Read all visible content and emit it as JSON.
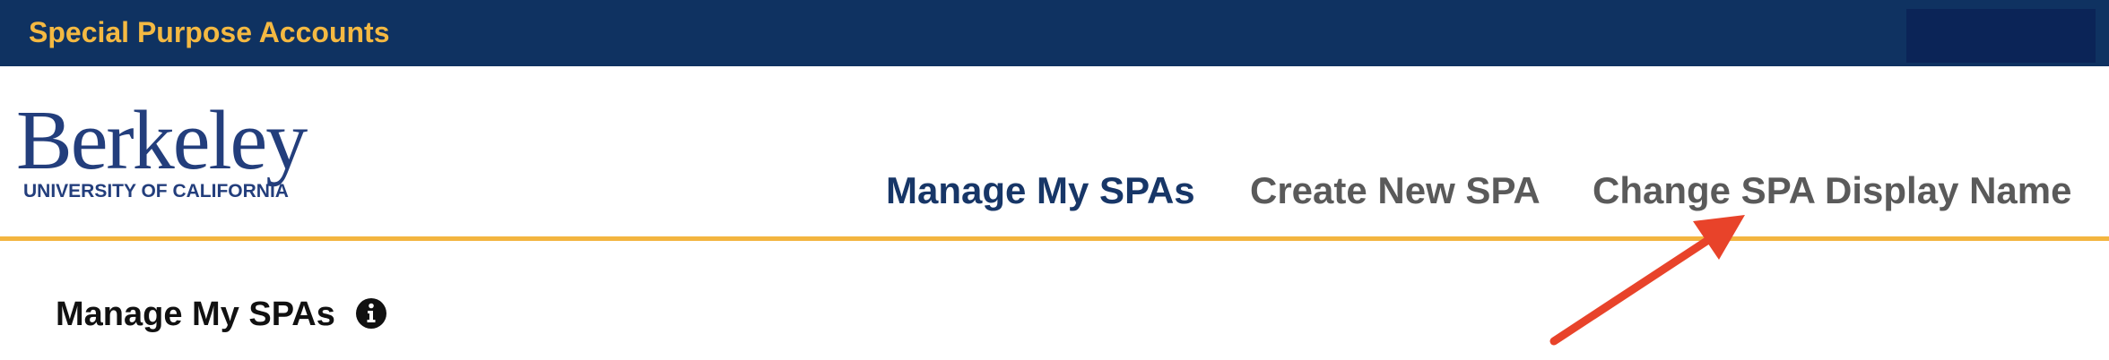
{
  "topbar": {
    "title": "Special Purpose Accounts"
  },
  "logo": {
    "wordmark": "Berkeley",
    "subtitle": "UNIVERSITY OF CALIFORNIA"
  },
  "nav": {
    "items": [
      {
        "label": "Manage My SPAs",
        "active": true
      },
      {
        "label": "Create New SPA",
        "active": false
      },
      {
        "label": "Change SPA Display Name",
        "active": false
      }
    ]
  },
  "main": {
    "title": "Manage My SPAs",
    "info_icon": "info-icon"
  },
  "annotation": {
    "arrow_color": "#e8432a"
  },
  "colors": {
    "topbar_bg": "#0f3261",
    "accent_gold": "#f4b942",
    "nav_active": "#173667",
    "nav_inactive": "#5a5a5a",
    "logo_blue": "#233e7c"
  }
}
